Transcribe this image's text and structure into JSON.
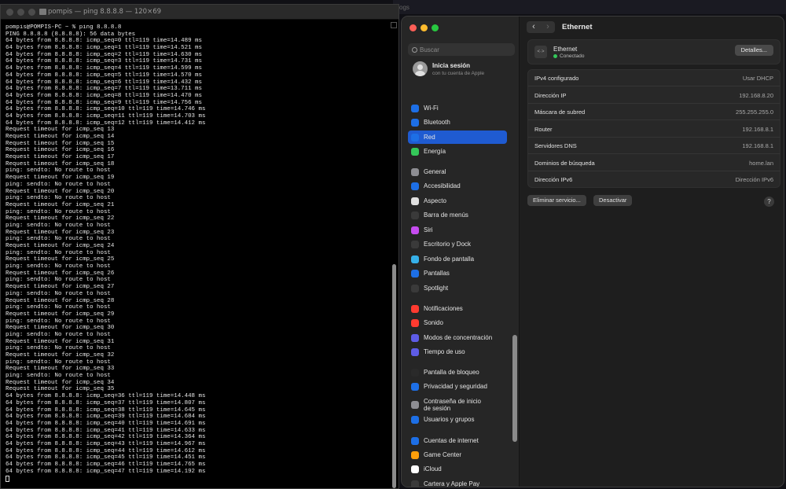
{
  "terminal": {
    "title": "pompis — ping 8.8.8.8 — 120×69",
    "lines": [
      "pompis@POMPIS-PC ~ % ping 8.8.8.8",
      "PING 8.8.8.8 (8.8.8.8): 56 data bytes",
      "64 bytes from 8.8.8.8: icmp_seq=0 ttl=119 time=14.489 ms",
      "64 bytes from 8.8.8.8: icmp_seq=1 ttl=119 time=14.521 ms",
      "64 bytes from 8.8.8.8: icmp_seq=2 ttl=119 time=14.630 ms",
      "64 bytes from 8.8.8.8: icmp_seq=3 ttl=119 time=14.731 ms",
      "64 bytes from 8.8.8.8: icmp_seq=4 ttl=119 time=14.599 ms",
      "64 bytes from 8.8.8.8: icmp_seq=5 ttl=119 time=14.570 ms",
      "64 bytes from 8.8.8.8: icmp_seq=6 ttl=119 time=14.432 ms",
      "64 bytes from 8.8.8.8: icmp_seq=7 ttl=119 time=13.711 ms",
      "64 bytes from 8.8.8.8: icmp_seq=8 ttl=119 time=14.470 ms",
      "64 bytes from 8.8.8.8: icmp_seq=9 ttl=119 time=14.756 ms",
      "64 bytes from 8.8.8.8: icmp_seq=10 ttl=119 time=14.746 ms",
      "64 bytes from 8.8.8.8: icmp_seq=11 ttl=119 time=14.703 ms",
      "64 bytes from 8.8.8.8: icmp_seq=12 ttl=119 time=14.412 ms",
      "Request timeout for icmp_seq 13",
      "Request timeout for icmp_seq 14",
      "Request timeout for icmp_seq 15",
      "Request timeout for icmp_seq 16",
      "Request timeout for icmp_seq 17",
      "Request timeout for icmp_seq 18",
      "ping: sendto: No route to host",
      "Request timeout for icmp_seq 19",
      "ping: sendto: No route to host",
      "Request timeout for icmp_seq 20",
      "ping: sendto: No route to host",
      "Request timeout for icmp_seq 21",
      "ping: sendto: No route to host",
      "Request timeout for icmp_seq 22",
      "ping: sendto: No route to host",
      "Request timeout for icmp_seq 23",
      "ping: sendto: No route to host",
      "Request timeout for icmp_seq 24",
      "ping: sendto: No route to host",
      "Request timeout for icmp_seq 25",
      "ping: sendto: No route to host",
      "Request timeout for icmp_seq 26",
      "ping: sendto: No route to host",
      "Request timeout for icmp_seq 27",
      "ping: sendto: No route to host",
      "Request timeout for icmp_seq 28",
      "ping: sendto: No route to host",
      "Request timeout for icmp_seq 29",
      "ping: sendto: No route to host",
      "Request timeout for icmp_seq 30",
      "ping: sendto: No route to host",
      "Request timeout for icmp_seq 31",
      "ping: sendto: No route to host",
      "Request timeout for icmp_seq 32",
      "ping: sendto: No route to host",
      "Request timeout for icmp_seq 33",
      "ping: sendto: No route to host",
      "Request timeout for icmp_seq 34",
      "Request timeout for icmp_seq 35",
      "64 bytes from 8.8.8.8: icmp_seq=36 ttl=119 time=14.448 ms",
      "64 bytes from 8.8.8.8: icmp_seq=37 ttl=119 time=14.807 ms",
      "64 bytes from 8.8.8.8: icmp_seq=38 ttl=119 time=14.645 ms",
      "64 bytes from 8.8.8.8: icmp_seq=39 ttl=119 time=14.684 ms",
      "64 bytes from 8.8.8.8: icmp_seq=40 ttl=119 time=14.691 ms",
      "64 bytes from 8.8.8.8: icmp_seq=41 ttl=119 time=14.633 ms",
      "64 bytes from 8.8.8.8: icmp_seq=42 ttl=119 time=14.364 ms",
      "64 bytes from 8.8.8.8: icmp_seq=43 ttl=119 time=14.967 ms",
      "64 bytes from 8.8.8.8: icmp_seq=44 ttl=119 time=14.612 ms",
      "64 bytes from 8.8.8.8: icmp_seq=45 ttl=119 time=14.451 ms",
      "64 bytes from 8.8.8.8: icmp_seq=46 ttl=119 time=14.765 ms",
      "64 bytes from 8.8.8.8: icmp_seq=47 ttl=119 time=14.192 ms",
      ""
    ]
  },
  "background_tab": "ogs",
  "settings": {
    "search_placeholder": "Buscar",
    "account": {
      "title": "Inicia sesión",
      "subtitle": "con tu cuenta de Apple"
    },
    "sidebar": [
      {
        "label": "Wi-Fi",
        "icon": "wifi-icon",
        "color": "#1d6fe6"
      },
      {
        "label": "Bluetooth",
        "icon": "bluetooth-icon",
        "color": "#1d6fe6"
      },
      {
        "label": "Red",
        "icon": "network-globe-icon",
        "color": "#1d6fe6",
        "active": true
      },
      {
        "label": "Energía",
        "icon": "battery-icon",
        "color": "#34c759"
      },
      {
        "label": "General",
        "icon": "gear-icon",
        "color": "#8e8e93"
      },
      {
        "label": "Accesibilidad",
        "icon": "accessibility-icon",
        "color": "#1d6fe6"
      },
      {
        "label": "Aspecto",
        "icon": "appearance-icon",
        "color": "#e0e0e0"
      },
      {
        "label": "Barra de menús",
        "icon": "menu-bar-icon",
        "color": "#3a3a3a"
      },
      {
        "label": "Siri",
        "icon": "siri-icon",
        "color": "#c64cf0"
      },
      {
        "label": "Escritorio y Dock",
        "icon": "dock-icon",
        "color": "#3a3a3a"
      },
      {
        "label": "Fondo de pantalla",
        "icon": "wallpaper-icon",
        "color": "#36b0e8"
      },
      {
        "label": "Pantallas",
        "icon": "display-icon",
        "color": "#1d6fe6"
      },
      {
        "label": "Spotlight",
        "icon": "spotlight-icon",
        "color": "#3a3a3a"
      },
      {
        "label": "Notificaciones",
        "icon": "notifications-icon",
        "color": "#ff3b30"
      },
      {
        "label": "Sonido",
        "icon": "sound-icon",
        "color": "#ff3b30"
      },
      {
        "label": "Modos de concentración",
        "icon": "focus-moon-icon",
        "color": "#5e5ce6"
      },
      {
        "label": "Tiempo de uso",
        "icon": "screen-time-icon",
        "color": "#5e5ce6"
      },
      {
        "label": "Pantalla de bloqueo",
        "icon": "lock-screen-icon",
        "color": "#2a2a2a"
      },
      {
        "label": "Privacidad y seguridad",
        "icon": "privacy-hand-icon",
        "color": "#1d6fe6"
      },
      {
        "label": "Contraseña de inicio de sesión",
        "icon": "password-icon",
        "color": "#8e8e93"
      },
      {
        "label": "Usuarios y grupos",
        "icon": "users-icon",
        "color": "#1d6fe6"
      },
      {
        "label": "Cuentas de internet",
        "icon": "internet-accounts-icon",
        "color": "#1d6fe6"
      },
      {
        "label": "Game Center",
        "icon": "game-center-icon",
        "color": "#ff9f0a"
      },
      {
        "label": "iCloud",
        "icon": "icloud-icon",
        "color": "#ffffff"
      },
      {
        "label": "Cartera y Apple Pay",
        "icon": "wallet-icon",
        "color": "#3a3a3a"
      }
    ],
    "main": {
      "title": "Ethernet",
      "back_icon": "‹",
      "forward_icon": "›",
      "interface": {
        "name": "Ethernet",
        "status": "Conectado",
        "details_label": "Detalles..."
      },
      "rows": [
        {
          "key": "IPv4 configurado",
          "value": "Usar DHCP"
        },
        {
          "key": "Dirección IP",
          "value": "192.168.8.20"
        },
        {
          "key": "Máscara de subred",
          "value": "255.255.255.0"
        },
        {
          "key": "Router",
          "value": "192.168.8.1"
        },
        {
          "key": "Servidores DNS",
          "value": "192.168.8.1"
        },
        {
          "key": "Dominios de búsqueda",
          "value": "home.lan"
        },
        {
          "key": "Dirección IPv6",
          "value": "Dirección IPv6"
        }
      ],
      "remove_service_label": "Eliminar servicio...",
      "deactivate_label": "Desactivar",
      "help_label": "?"
    }
  }
}
